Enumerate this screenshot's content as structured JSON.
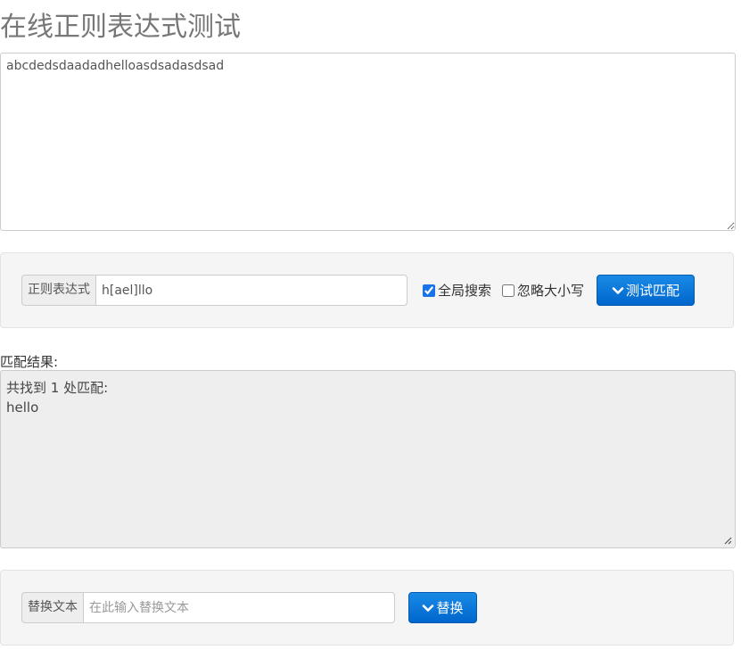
{
  "page": {
    "title": "在线正则表达式测试"
  },
  "source": {
    "value": "abcdedsdaadadhelloasdsadasdsad"
  },
  "regex_panel": {
    "addon_label": "正则表达式",
    "pattern_value": "h[ael]llo",
    "global_label": "全局搜索",
    "global_checked": true,
    "ignore_case_label": "忽略大小写",
    "ignore_case_checked": false,
    "test_button_label": "测试匹配"
  },
  "result": {
    "label": "匹配结果:",
    "summary": "共找到 1 处匹配:",
    "matches": [
      "hello"
    ]
  },
  "replace_panel": {
    "addon_label": "替换文本",
    "replace_value": "",
    "replace_placeholder": "在此输入替换文本",
    "replace_button_label": "替换"
  },
  "icons": {
    "button_icon": "chevron-down-icon",
    "resize_icon": "resize-grip-icon"
  },
  "colors": {
    "primary_button": "#0066cc",
    "well_background": "#f5f5f5",
    "result_background": "#eeeeee"
  }
}
